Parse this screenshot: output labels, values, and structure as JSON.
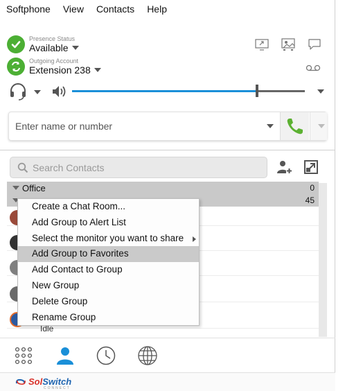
{
  "menubar": {
    "items": [
      "Softphone",
      "View",
      "Contacts",
      "Help"
    ]
  },
  "presence": {
    "small_label": "Presence Status",
    "value": "Available"
  },
  "account": {
    "small_label": "Outgoing Account",
    "value": "Extension 238"
  },
  "audio": {
    "volume_level": 0.8
  },
  "dialer": {
    "placeholder": "Enter name or number"
  },
  "search": {
    "placeholder": "Search Contacts"
  },
  "groups": [
    {
      "name": "Office",
      "count": "0"
    },
    {
      "name": "",
      "count": "45"
    }
  ],
  "contact_status": "Idle",
  "context_menu": {
    "items": [
      {
        "label": "Create a Chat Room..."
      },
      {
        "label": "Add Group to Alert List"
      },
      {
        "label": "Select the monitor you want to share"
      },
      {
        "label": "Add Group to Favorites"
      },
      {
        "label": "Add Contact to Group"
      },
      {
        "label": "New Group"
      },
      {
        "label": "Delete Group"
      },
      {
        "label": "Rename Group"
      }
    ]
  },
  "footer": {
    "logo_text_a": "Sol",
    "logo_text_b": "Switch",
    "logo_sub": "CONNECT"
  },
  "colors": {
    "accent": "#1a8fd8",
    "available": "#4caf34",
    "call": "#5cb132",
    "logo_blue": "#1e64b0",
    "logo_red": "#d9312a"
  },
  "icons": [
    "check-icon",
    "call-switch-icon",
    "screen-share-icon",
    "monitor-share-icon",
    "chat-bubble-icon",
    "voicemail-icon",
    "headset-icon",
    "speaker-icon",
    "phone-icon",
    "search-icon",
    "add-contact-icon",
    "popout-icon",
    "dialpad-icon",
    "contacts-icon",
    "history-icon",
    "globe-icon"
  ]
}
